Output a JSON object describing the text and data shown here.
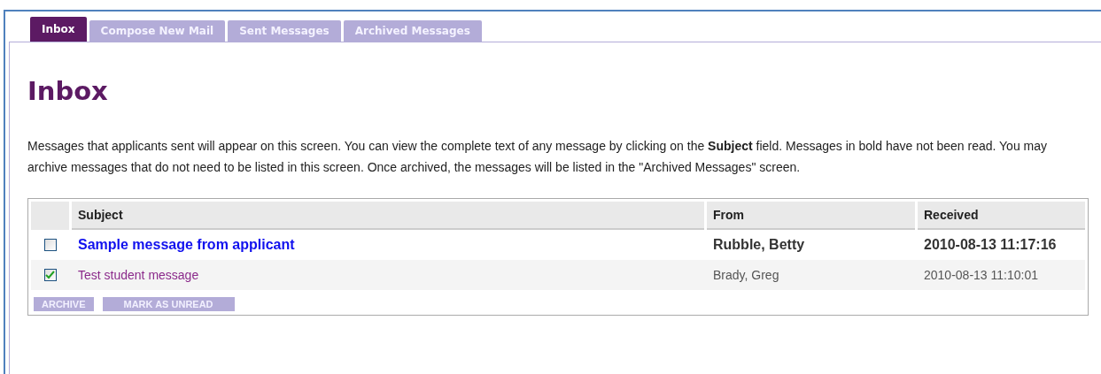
{
  "tabs": [
    {
      "label": "Inbox",
      "selected": true
    },
    {
      "label": "Compose New Mail",
      "selected": false
    },
    {
      "label": "Sent Messages",
      "selected": false
    },
    {
      "label": "Archived Messages",
      "selected": false
    }
  ],
  "heading": "Inbox",
  "intro": "Messages that applicants sent will appear on this screen. You can view the complete text of any message by clicking on the **Subject** field. Messages in bold have not been read. You may archive messages that do not need to be listed in this screen. Once archived, the messages will be listed in the \"Archived Messages\" screen.",
  "table": {
    "columns": [
      "Subject",
      "From",
      "Received"
    ],
    "rows": [
      {
        "checked": false,
        "unread": true,
        "subject": "Sample message from applicant",
        "from": "Rubble, Betty",
        "received": "2010-08-13 11:17:16"
      },
      {
        "checked": true,
        "unread": false,
        "subject": "Test student message",
        "from": "Brady, Greg",
        "received": "2010-08-13 11:10:01"
      }
    ]
  },
  "buttons": [
    "ARCHIVE",
    "MARK AS UNREAD"
  ]
}
